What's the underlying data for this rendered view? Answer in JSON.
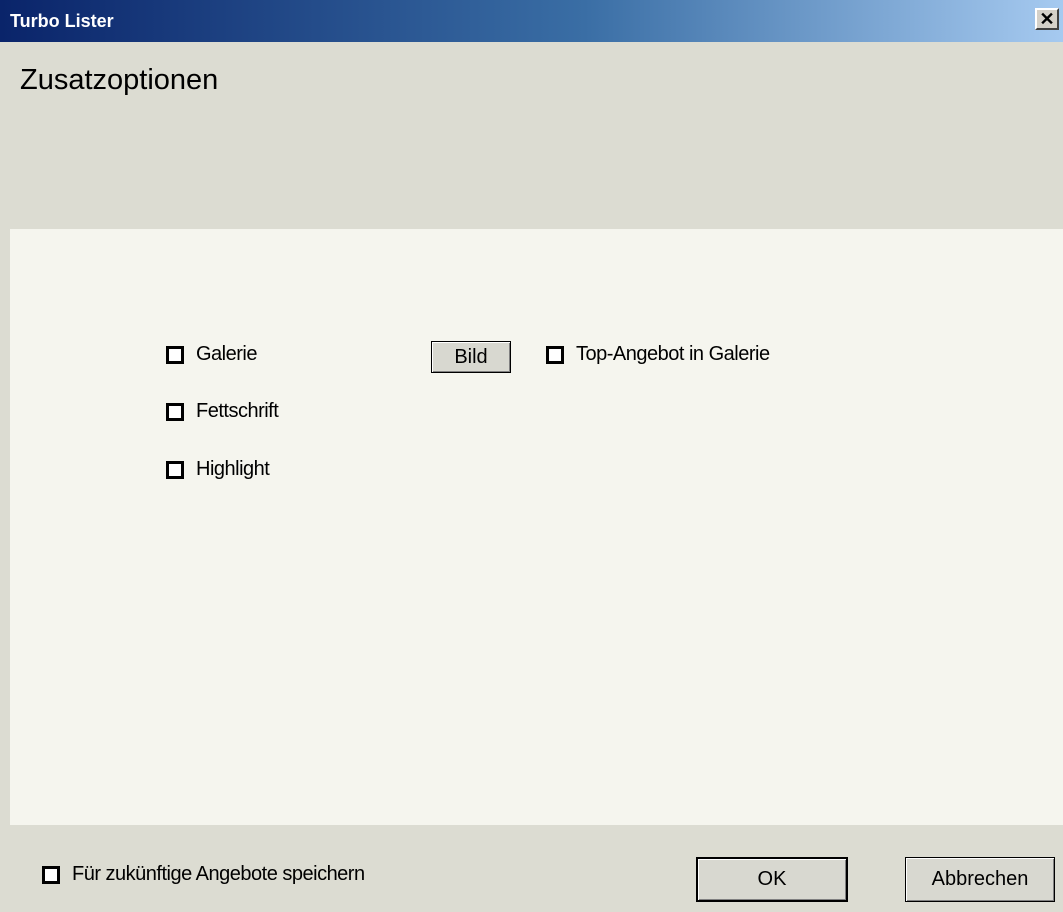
{
  "window": {
    "title": "Turbo Lister",
    "close_glyph": "✕"
  },
  "header": {
    "title": "Zusatzoptionen"
  },
  "options": {
    "galerie": {
      "label": "Galerie",
      "checked": false
    },
    "fettschrift": {
      "label": "Fettschrift",
      "checked": false
    },
    "highlight": {
      "label": "Highlight",
      "checked": false
    },
    "bild_button": "Bild",
    "top_angebot": {
      "label": "Top-Angebot in Galerie",
      "checked": false
    }
  },
  "footer": {
    "save_future": {
      "label": "Für zukünftige Angebote speichern",
      "checked": false
    },
    "ok_label": "OK",
    "cancel_label": "Abbrechen"
  }
}
